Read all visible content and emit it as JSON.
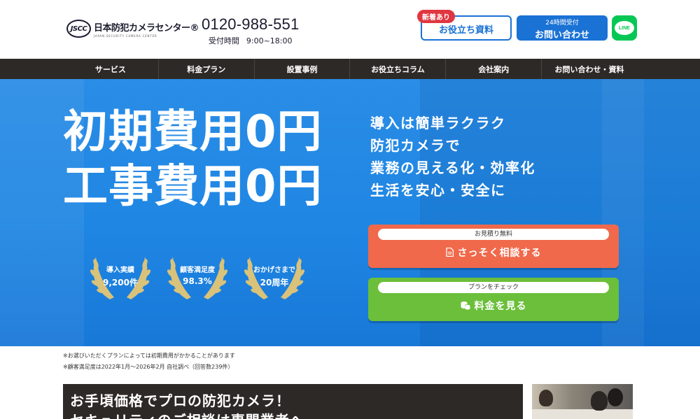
{
  "header": {
    "logo_mark": "JSCC",
    "logo_name": "日本防犯カメラセンター®",
    "logo_sub": "JAPAN SECURITY CAMERA CENTER",
    "phone": "0120-988-551",
    "hours_label": "受付時間",
    "hours_value": "9:00~18:00",
    "badge_new": "新着あり",
    "docs_button": "お役立ち資料",
    "contact_small": "24時間受付",
    "contact_button": "お問い合わせ",
    "line_label": "LINE"
  },
  "nav": {
    "items": [
      "サービス",
      "料金プラン",
      "設置事例",
      "お役立ちコラム",
      "会社案内",
      "お問い合わせ・資料"
    ]
  },
  "hero": {
    "title_line1": "初期費用0円",
    "title_line2": "工事費用0円",
    "sub_lines": [
      "導入は簡単ラクラク",
      "防犯カメラで",
      "業務の見える化・効率化",
      "生活を安心・安全に"
    ],
    "awards": [
      {
        "line1": "導入実績",
        "line2": "9,200件"
      },
      {
        "line1": "顧客満足度",
        "line2": "98.3%"
      },
      {
        "line1": "おかげさまで",
        "line2": "20周年"
      }
    ],
    "cta_estimate": {
      "pill": "お見積り無料",
      "label": "さっそく相談する",
      "icon": "document-icon"
    },
    "cta_price": {
      "pill": "プランをチェック",
      "label": "料金を見る",
      "icon": "coins-icon"
    }
  },
  "notes": [
    "※お選びいただくプランによっては初期費用がかかることがあります",
    "※顧客満足度は2022年1月～2026年2月 自社調べ（回答数239件）"
  ],
  "banner": {
    "line1": "お手頃価格でプロの防犯カメラ！",
    "line2": "セキュリティのご相談は専門業者へ"
  },
  "colors": {
    "brand_blue": "#1a72d5",
    "nav_dark": "#2d2926",
    "cta_orange": "#f0694b",
    "cta_green": "#6bbf3a",
    "line_green": "#06c755",
    "badge_red": "#e03640"
  }
}
